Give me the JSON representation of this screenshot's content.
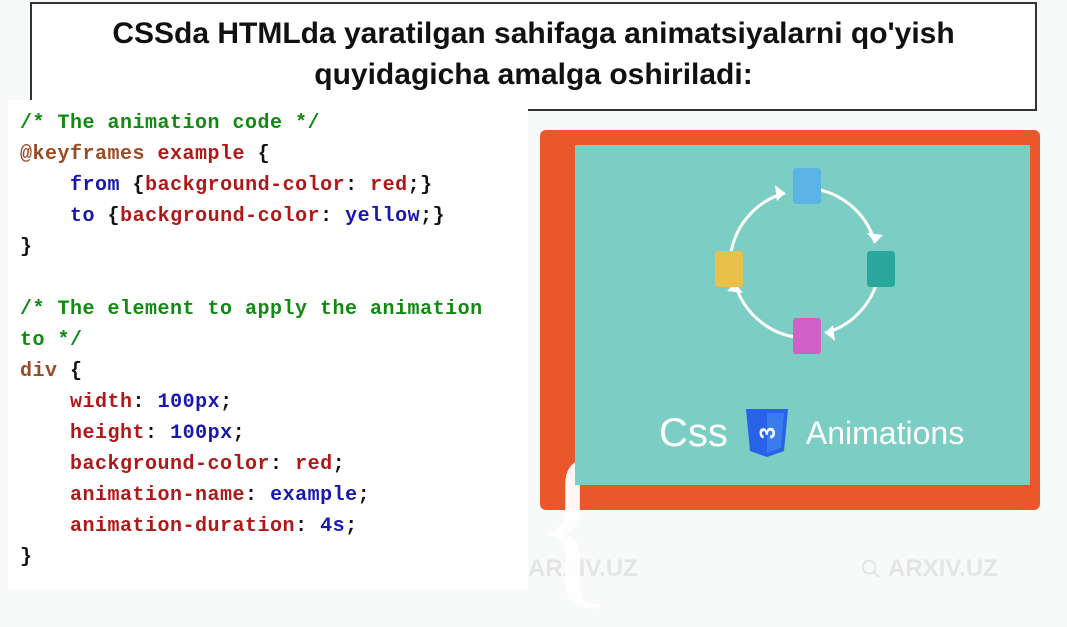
{
  "watermark_text": "ARXIV.UZ",
  "title": "CSSda HTMLda yaratilgan sahifaga animatsiyalarni qo'yish quyidagicha amalga oshiriladi:",
  "code": {
    "comment1": "/* The animation code */",
    "atrule": "@keyframes",
    "atrule_name": "example",
    "from_kw": "from",
    "to_kw": "to",
    "bg_prop": "background-color",
    "red_val": "red",
    "yellow_val": "yellow",
    "comment2a": "/* The element to apply the animation",
    "comment2b": "to */",
    "selector": "div",
    "width_prop": "width",
    "height_prop": "height",
    "px100": "100px",
    "anim_name_prop": "animation-name",
    "anim_name_val": "example",
    "anim_dur_prop": "animation-duration",
    "anim_dur_val": "4s"
  },
  "graphic": {
    "css_label": "Css",
    "anim_label": "Animations"
  }
}
